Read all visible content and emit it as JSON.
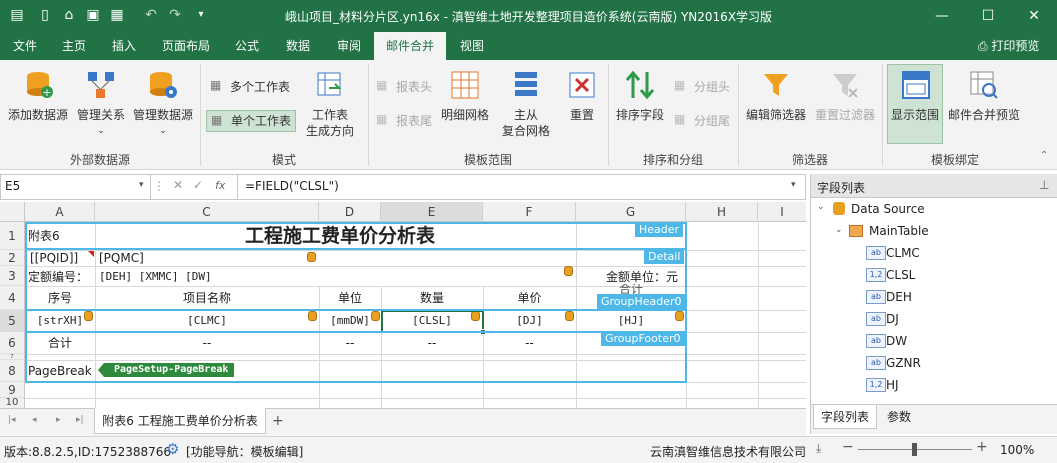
{
  "window": {
    "title": "峨山项目_材料分片区.yn16x - 滇智维土地开发整理项目造价系统(云南版) YN2016X学习版",
    "print_preview": "打印预览"
  },
  "menu_tabs": [
    "文件",
    "主页",
    "插入",
    "页面布局",
    "公式",
    "数据",
    "审阅",
    "邮件合并",
    "视图"
  ],
  "ribbon": {
    "add_datasource": "添加数据源",
    "manage_relation": "管理关系",
    "manage_datasource": "管理数据源",
    "group_external": "外部数据源",
    "multi_sheet": "多个工作表",
    "single_sheet": "单个工作表",
    "sheet_gen_dir_1": "工作表",
    "sheet_gen_dir_2": "生成方向",
    "group_mode": "模式",
    "report_header": "报表头",
    "report_footer": "报表尾",
    "detail_grid": "明细网格",
    "master_1": "主从",
    "master_2": "复合网格",
    "reset": "重置",
    "group_template": "模板范围",
    "sort_field": "排序字段",
    "group_header": "分组头",
    "group_footer": "分组尾",
    "group_sort": "排序和分组",
    "edit_filter": "编辑筛选器",
    "reset_filter": "重置过滤器",
    "group_filter": "筛选器",
    "show_range": "显示范围",
    "merge_preview": "邮件合并预览",
    "group_bind": "模板绑定"
  },
  "formula": {
    "name_box": "E5",
    "fx": "fx",
    "content": "=FIELD(\"CLSL\")"
  },
  "columns": [
    "A",
    "C",
    "D",
    "E",
    "F",
    "G",
    "H",
    "I"
  ],
  "rows": [
    "1",
    "2",
    "3",
    "4",
    "5",
    "6",
    "7",
    "8",
    "9",
    "10"
  ],
  "sheet": {
    "a1": "附表6",
    "title": "工程施工费单价分析表",
    "a2": "[[PQID]]",
    "c2": "[PQMC]",
    "a3": "定额编号：",
    "c3": "[DEH] [XMMC] [DW]",
    "g3": "金额单位：元",
    "h_seq": "序号",
    "h_name": "项目名称",
    "h_unit": "单位",
    "h_qty": "数量",
    "h_price": "单价",
    "h_total": "合计",
    "r5_a": "[strXH]",
    "r5_c": "[CLMC]",
    "r5_d": "[mmDW]",
    "r5_e": "[CLSL]",
    "r5_f": "[DJ]",
    "r5_g": "[HJ]",
    "r6_a": "合计",
    "dash": "--",
    "pagebreak": "PageBreak",
    "pagesetup": "PageSetup-PageBreak"
  },
  "bands": {
    "header": "Header",
    "detail": "Detail",
    "group_header": "GroupHeader0",
    "group_footer": "GroupFooter0"
  },
  "sheet_tab": "附表6 工程施工费单价分析表",
  "panel": {
    "title": "字段列表",
    "root": "Data Source",
    "table": "MainTable",
    "fields": [
      {
        "name": "CLMC",
        "type": "ab"
      },
      {
        "name": "CLSL",
        "type": "1,2"
      },
      {
        "name": "DEH",
        "type": "ab"
      },
      {
        "name": "DJ",
        "type": "ab"
      },
      {
        "name": "DW",
        "type": "ab"
      },
      {
        "name": "GZNR",
        "type": "ab"
      },
      {
        "name": "HJ",
        "type": "1,2"
      }
    ],
    "tab_fields": "字段列表",
    "tab_params": "参数"
  },
  "status": {
    "version": "版本:8.8.2.5,ID:1752388766",
    "nav": "[功能导航：模板编辑]",
    "company": "云南滇智维信息技术有限公司",
    "zoom": "100%"
  }
}
